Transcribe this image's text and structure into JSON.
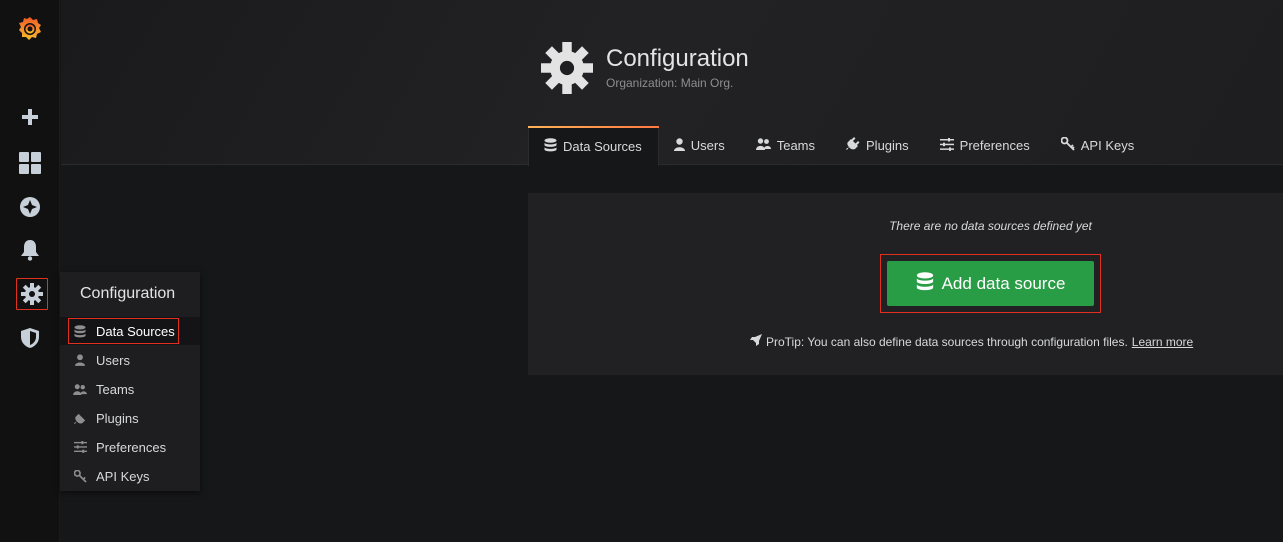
{
  "header": {
    "title": "Configuration",
    "subtitle": "Organization: Main Org."
  },
  "tabs": [
    {
      "label": "Data Sources",
      "icon": "database-icon",
      "active": true
    },
    {
      "label": "Users",
      "icon": "user-icon",
      "active": false
    },
    {
      "label": "Teams",
      "icon": "users-icon",
      "active": false
    },
    {
      "label": "Plugins",
      "icon": "plug-icon",
      "active": false
    },
    {
      "label": "Preferences",
      "icon": "sliders-icon",
      "active": false
    },
    {
      "label": "API Keys",
      "icon": "key-icon",
      "active": false
    }
  ],
  "empty_state": {
    "message": "There are no data sources defined yet",
    "button_label": "Add data source",
    "protip": "ProTip: You can also define data sources through configuration files.",
    "learn_more": "Learn more"
  },
  "dropdown": {
    "title": "Configuration",
    "items": [
      {
        "label": "Data Sources",
        "icon": "database-icon",
        "active": true
      },
      {
        "label": "Users",
        "icon": "user-icon"
      },
      {
        "label": "Teams",
        "icon": "users-icon"
      },
      {
        "label": "Plugins",
        "icon": "plug-icon"
      },
      {
        "label": "Preferences",
        "icon": "sliders-icon"
      },
      {
        "label": "API Keys",
        "icon": "key-icon"
      }
    ]
  },
  "sidebar": {
    "items": [
      "grafana-logo-icon",
      "plus-icon",
      "dashboards-icon",
      "explore-icon",
      "bell-icon",
      "gear-icon",
      "shield-icon"
    ]
  },
  "colors": {
    "accent_button": "#299c46",
    "highlight_frame": "#e0301e",
    "tab_gradient_start": "#ffb357",
    "tab_gradient_end": "#ff7941"
  }
}
